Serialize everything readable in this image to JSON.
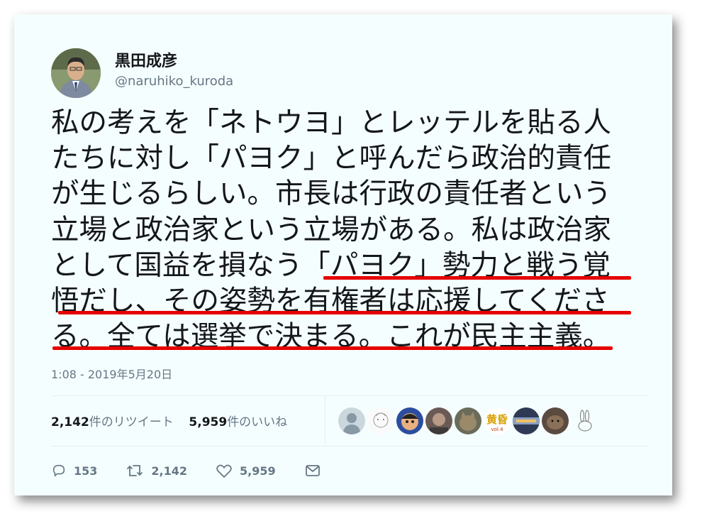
{
  "user": {
    "display_name": "黒田成彦",
    "handle": "@naruhiko_kuroda"
  },
  "tweet": {
    "lines": [
      "私の考えを「ネトウヨ」とレッテルを貼る人",
      "たちに対し「パヨク」と呼んだら政治的責任",
      "が生じるらしい。市長は行政の責任者という",
      "立場と政治家という立場がある。私は政治家",
      "として国益を損なう「パヨク」勢力と戦う覚",
      "悟だし、その姿勢を有権者は応援してくださ",
      "る。全ては選挙で決まる。これが民主主義。"
    ],
    "timestamp": "1:08 - 2019年5月20日"
  },
  "stats": {
    "retweet_count": "2,142",
    "retweet_label": "件のリツイート",
    "like_count": "5,959",
    "like_label": "件のいいね"
  },
  "actions": {
    "reply_count": "153",
    "retweet_count": "2,142",
    "like_count": "5,959"
  },
  "colors": {
    "highlight_underline": "#e60000",
    "secondary_text": "#657786"
  }
}
